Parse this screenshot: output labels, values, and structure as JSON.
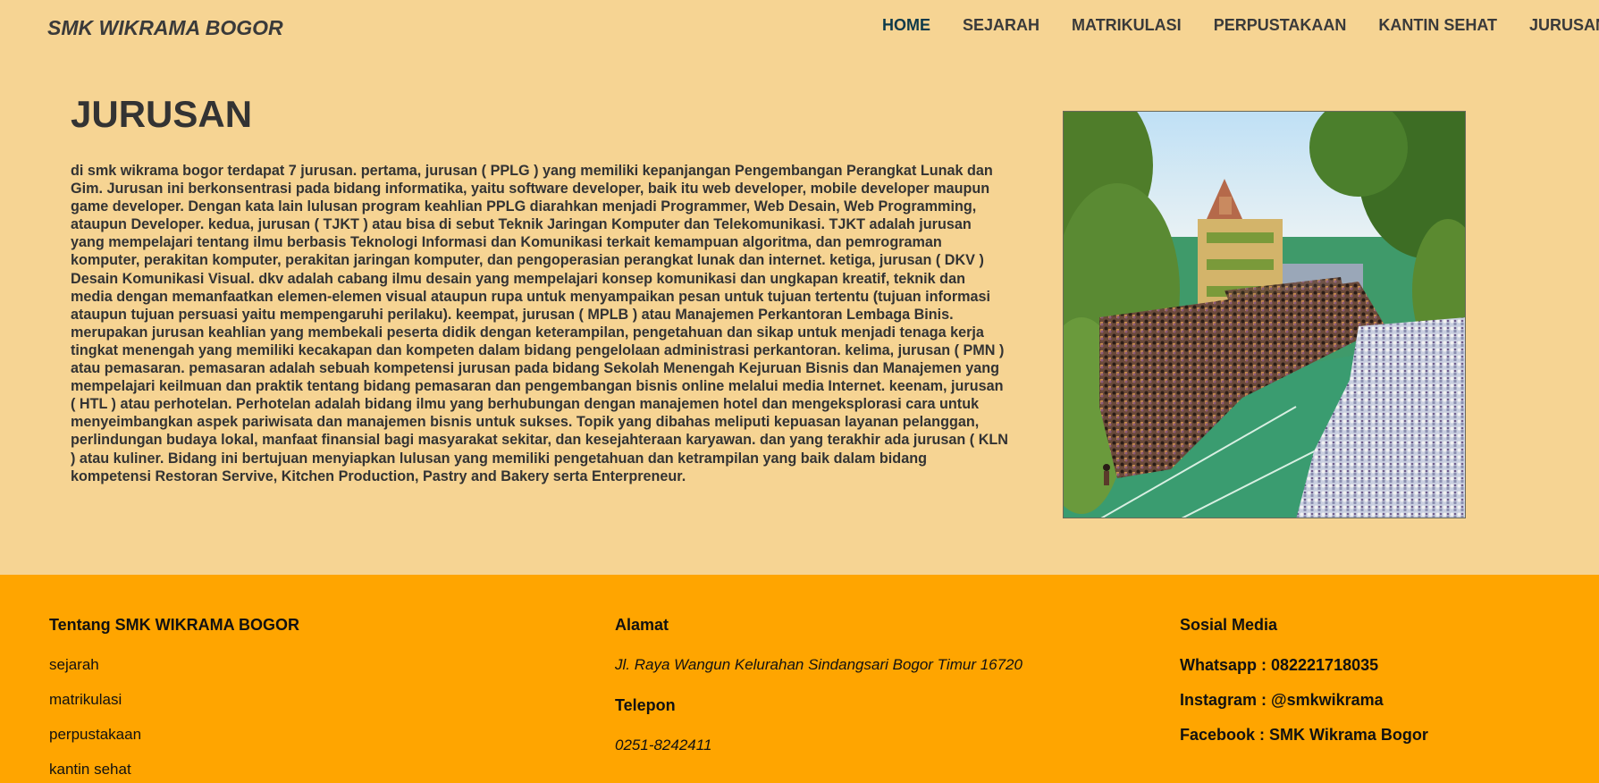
{
  "navbar": {
    "brand": "SMK WIKRAMA BOGOR",
    "links": [
      {
        "label": "HOME",
        "active": true
      },
      {
        "label": "SEJARAH"
      },
      {
        "label": "MATRIKULASI"
      },
      {
        "label": "PERPUSTAKAAN"
      },
      {
        "label": "KANTIN SEHAT"
      },
      {
        "label": "JURUSAN"
      }
    ]
  },
  "main": {
    "title": "JURUSAN",
    "body": "di smk wikrama bogor terdapat 7 jurusan. pertama, jurusan ( PPLG ) yang memiliki kepanjangan Pengembangan Perangkat Lunak dan Gim. Jurusan ini berkonsentrasi pada bidang informatika, yaitu software developer, baik itu web developer, mobile developer maupun game developer. Dengan kata lain lulusan program keahlian PPLG diarahkan menjadi Programmer, Web Desain, Web Programming, ataupun Developer. kedua, jurusan ( TJKT ) atau bisa di sebut Teknik Jaringan Komputer dan Telekomunikasi. TJKT adalah jurusan yang mempelajari tentang ilmu berbasis Teknologi Informasi dan Komunikasi terkait kemampuan algoritma, dan pemrograman komputer, perakitan komputer, perakitan jaringan komputer, dan pengoperasian perangkat lunak dan internet. ketiga, jurusan ( DKV ) Desain Komunikasi Visual. dkv adalah cabang ilmu desain yang mempelajari konsep komunikasi dan ungkapan kreatif, teknik dan media dengan memanfaatkan elemen-elemen visual ataupun rupa untuk menyampaikan pesan untuk tujuan tertentu (tujuan informasi ataupun tujuan persuasi yaitu mempengaruhi perilaku). keempat, jurusan ( MPLB ) atau Manajemen Perkantoran Lembaga Binis. merupakan jurusan keahlian yang membekali peserta didik dengan keterampilan, pengetahuan dan sikap untuk menjadi tenaga kerja tingkat menengah yang memiliki kecakapan dan kompeten dalam bidang pengelolaan administrasi perkantoran. kelima, jurusan ( PMN ) atau pemasaran. pemasaran adalah sebuah kompetensi jurusan pada bidang Sekolah Menengah Kejuruan Bisnis dan Manajemen yang mempelajari keilmuan dan praktik tentang bidang pemasaran dan pengembangan bisnis online melalui media Internet. keenam, jurusan ( HTL ) atau perhotelan. Perhotelan adalah bidang ilmu yang berhubungan dengan manajemen hotel dan mengeksplorasi cara untuk menyeimbangkan aspek pariwisata dan manajemen bisnis untuk sukses. Topik yang dibahas meliputi kepuasan layanan pelanggan, perlindungan budaya lokal, manfaat finansial bagi masyarakat sekitar, dan kesejahteraan karyawan. dan yang terakhir ada jurusan ( KLN ) atau kuliner. Bidang ini bertujuan menyiapkan lulusan yang memiliki pengetahuan dan ketrampilan yang baik dalam bidang kompetensi Restoran Servive, Kitchen Production, Pastry and Bakery serta Enterpreneur."
  },
  "footer": {
    "about": {
      "heading": "Tentang SMK WIKRAMA BOGOR",
      "links": [
        "sejarah",
        "matrikulasi",
        "perpustakaan",
        "kantin sehat"
      ]
    },
    "address": {
      "heading": "Alamat",
      "value": "Jl. Raya Wangun Kelurahan Sindangsari Bogor Timur 16720",
      "phone_heading": "Telepon",
      "phone_value": "0251-8242411"
    },
    "social": {
      "heading": "Sosial Media",
      "whatsapp": "Whatsapp : 082221718035",
      "instagram": "Instagram : @smkwikrama",
      "facebook": "Facebook : SMK Wikrama Bogor"
    }
  },
  "colors": {
    "page_bg": "#f6d493",
    "footer_bg": "#ffa500",
    "active_nav": "#0c3a4a",
    "text": "#333333"
  }
}
